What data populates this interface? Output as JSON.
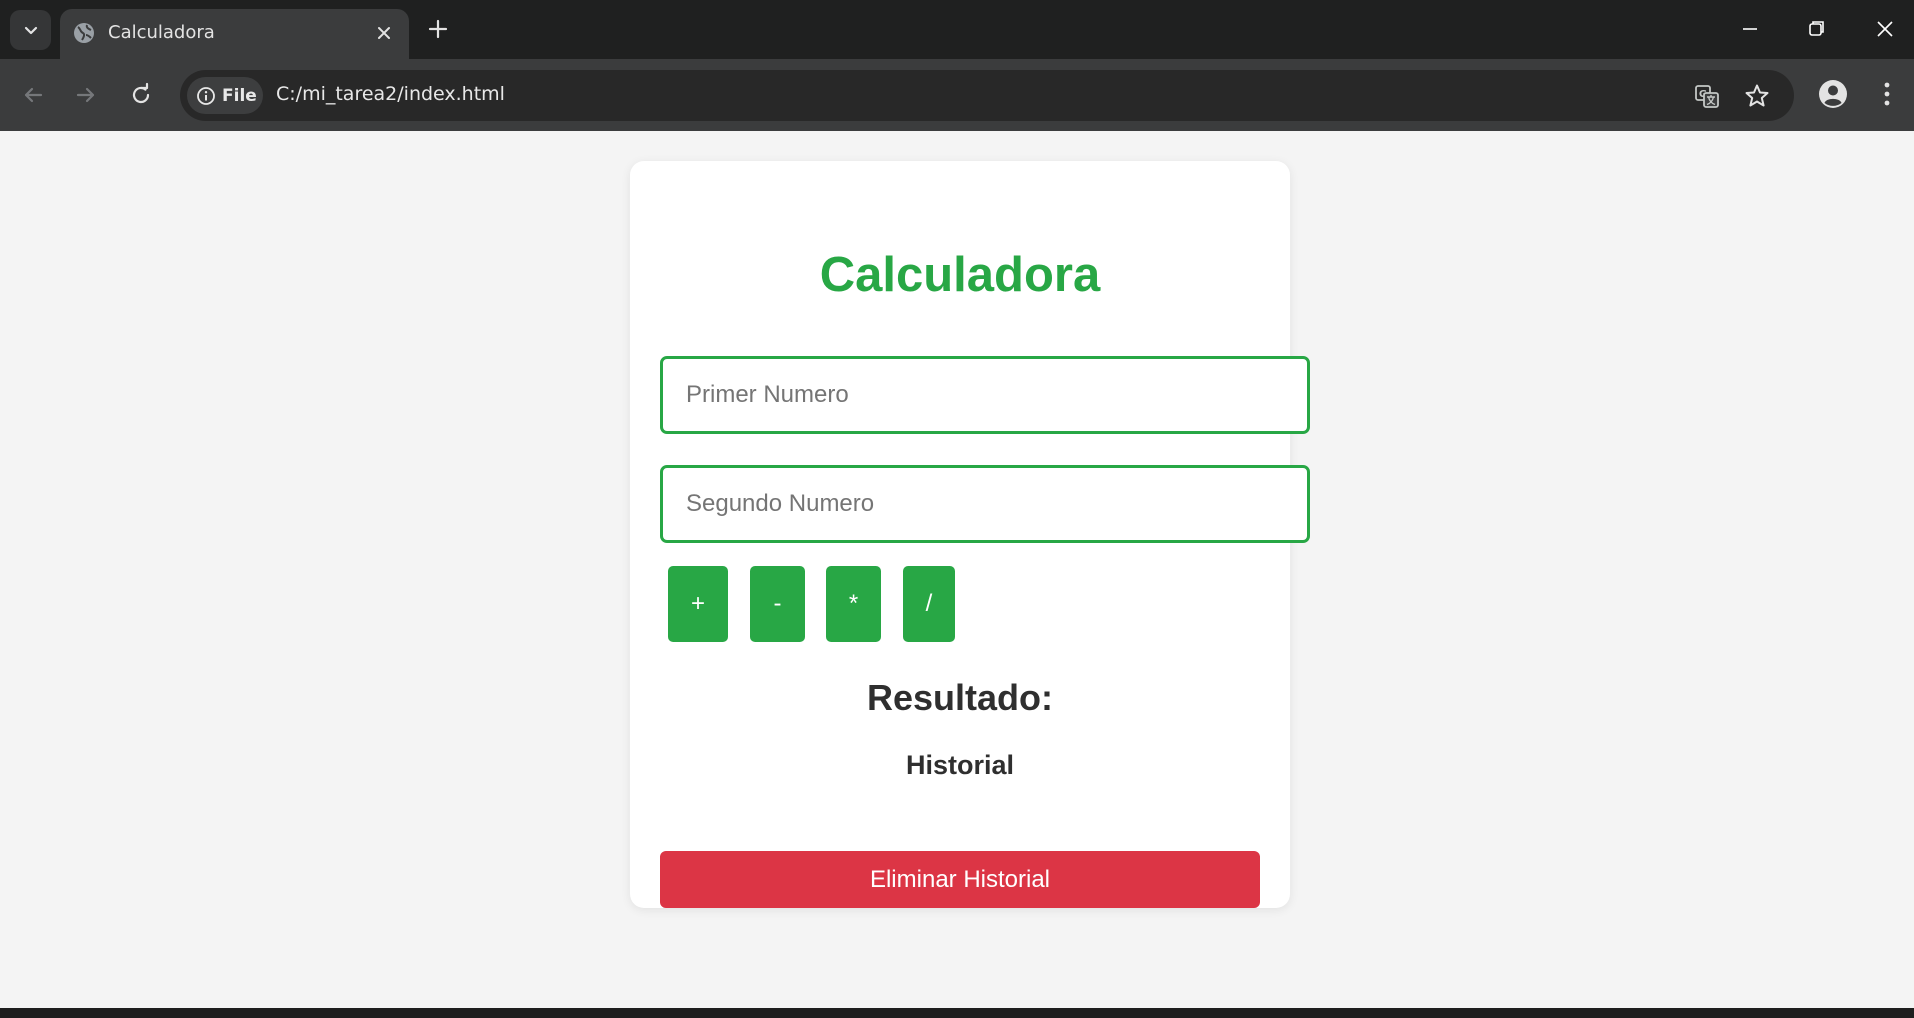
{
  "browser": {
    "tab": {
      "title": "Calculadora"
    },
    "address_bar": {
      "site_info_label": "File",
      "url": "C:/mi_tarea2/index.html"
    }
  },
  "calculator": {
    "title": "Calculadora",
    "inputs": {
      "first": {
        "placeholder": "Primer Numero",
        "value": ""
      },
      "second": {
        "placeholder": "Segundo Numero",
        "value": ""
      }
    },
    "operations": {
      "add": "+",
      "subtract": "-",
      "multiply": "*",
      "divide": "/"
    },
    "result_label": "Resultado:",
    "history_label": "Historial",
    "clear_history_label": "Eliminar Historial"
  },
  "colors": {
    "accent_green": "#28a745",
    "danger_red": "#dc3545",
    "page_background": "#f4f4f4"
  }
}
